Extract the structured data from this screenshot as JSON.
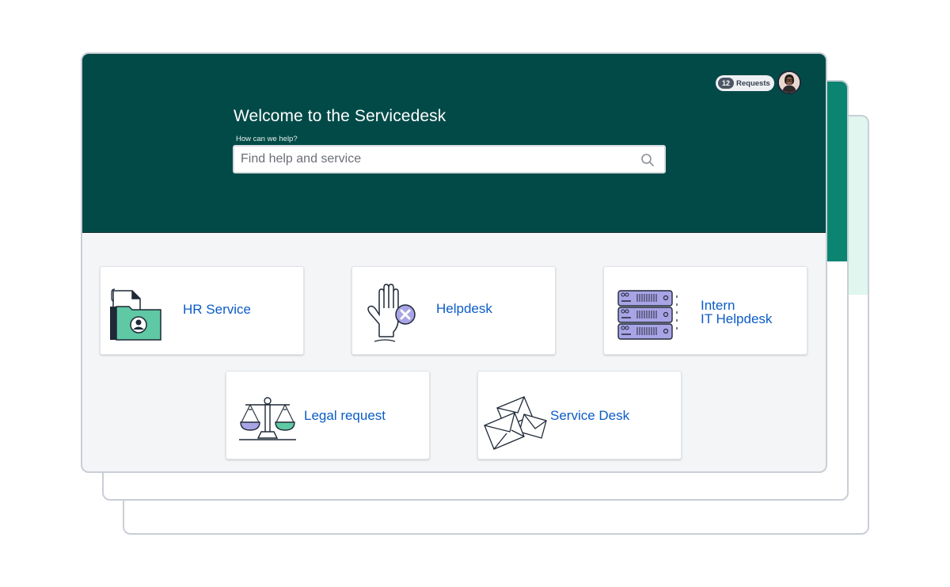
{
  "header": {
    "title": "Welcome to the Servicedesk",
    "help_label": "How can we help?",
    "search_placeholder": "Find help and service",
    "requests_count": "12",
    "requests_label": "Requests"
  },
  "cards": [
    {
      "label": "HR Service",
      "icon": "hr-folder-person-icon"
    },
    {
      "label": "Helpdesk",
      "icon": "raised-hand-icon"
    },
    {
      "label_line1": "Intern",
      "label_line2": "IT Helpdesk",
      "icon": "server-rack-icon"
    },
    {
      "label": "Legal request",
      "icon": "scales-icon"
    },
    {
      "label": "Service Desk",
      "icon": "envelopes-icon"
    }
  ],
  "colors": {
    "header_bg": "#024a47",
    "accent_green": "#0b8572",
    "mint": "#dff7ef",
    "link_blue": "#0b5cc7",
    "page_bg": "#f4f5f7"
  }
}
